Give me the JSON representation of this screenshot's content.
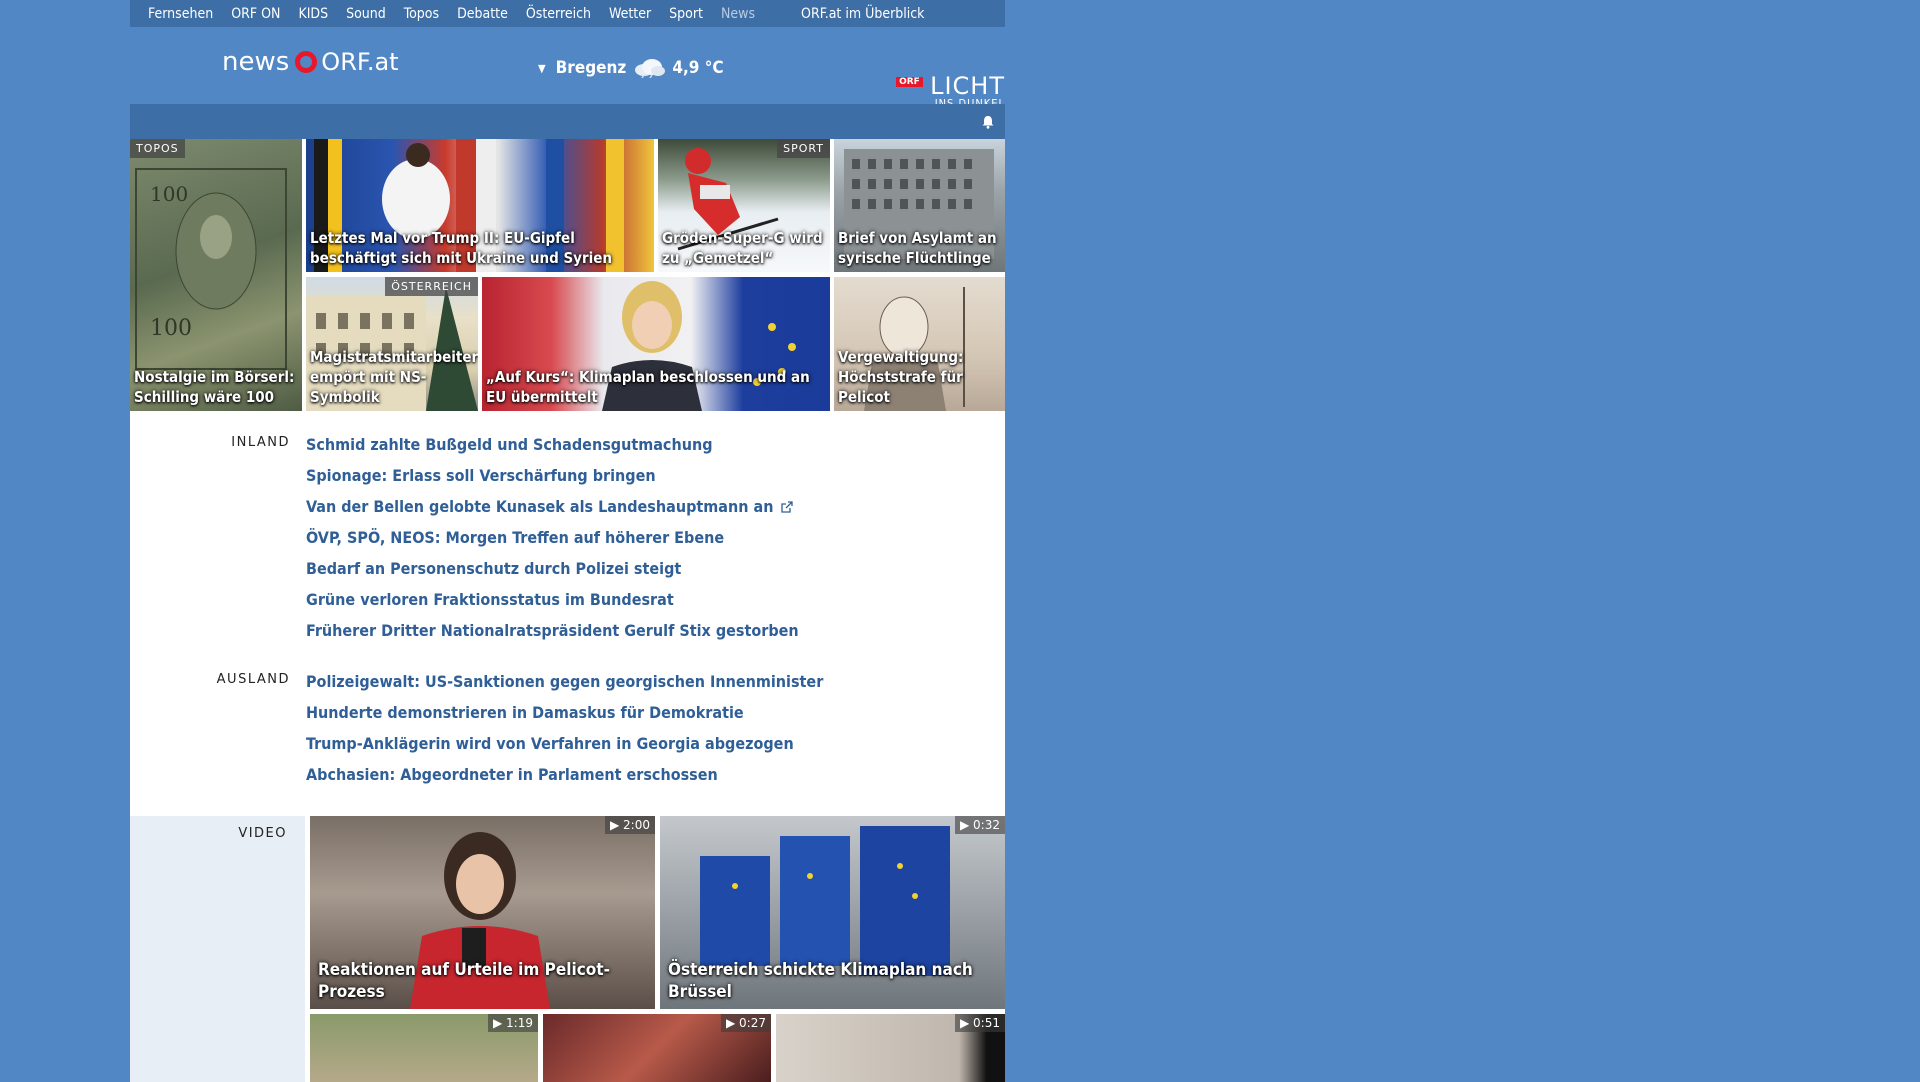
{
  "topnav": {
    "items": [
      "Fernsehen",
      "ORF ON",
      "KIDS",
      "Sound",
      "Topos",
      "Debatte",
      "Österreich",
      "Wetter",
      "Sport",
      "News"
    ],
    "overview": "ORF.at im Überblick"
  },
  "header": {
    "logo_news": "news",
    "logo_orf": "ORF.at",
    "weather_city": "Bregenz",
    "weather_temp": "4,9 °C",
    "licht_badge": "ORF",
    "licht_big": "LICHT",
    "licht_small": "INS DUNKEL"
  },
  "tiles": [
    {
      "tag": "TOPOS",
      "label": "Nostalgie im Börserl: Schilling wäre 100"
    },
    {
      "tag": "",
      "label": "Letztes Mal vor Trump II: EU-Gipfel beschäftigt sich mit Ukraine und Syrien"
    },
    {
      "tag": "SPORT",
      "label": "Gröden-Super-G wird zu „Gemetzel“"
    },
    {
      "tag": "",
      "label": "Brief von Asylamt an syrische Flüchtlinge"
    },
    {
      "tag": "ÖSTERREICH",
      "label": "Magistratsmitarbeiter empört mit NS-Symbolik"
    },
    {
      "tag": "",
      "label": "„Auf Kurs“: Klimaplan beschlossen und an EU übermittelt"
    },
    {
      "tag": "",
      "label": "Vergewaltigung: Höchststrafe für Pelicot"
    }
  ],
  "inland": {
    "heading": "INLAND",
    "items": [
      "Schmid zahlte Bußgeld und Schadensgutmachung",
      "Spionage: Erlass soll Verschärfung bringen",
      "Van der Bellen gelobte Kunasek als Landeshauptmann an",
      "ÖVP, SPÖ, NEOS: Morgen Treffen auf höherer Ebene",
      "Bedarf an Personenschutz durch Polizei steigt",
      "Grüne verloren Fraktionsstatus im Bundesrat",
      "Früherer Dritter Nationalratspräsident Gerulf Stix gestorben"
    ]
  },
  "ausland": {
    "heading": "AUSLAND",
    "items": [
      "Polizeigewalt: US-Sanktionen gegen georgischen Innenminister",
      "Hunderte demonstrieren in Damaskus für Demokratie",
      "Trump-Anklägerin wird von Verfahren in Georgia abgezogen",
      "Abchasien: Abgeordneter in Parlament erschossen"
    ]
  },
  "video": {
    "heading": "VIDEO",
    "items": [
      {
        "duration": "▶ 2:00",
        "label": "Reaktionen auf Urteile im Pelicot-Prozess"
      },
      {
        "duration": "▶ 0:32",
        "label": "Österreich schickte Klimaplan nach Brüssel"
      },
      {
        "duration": "▶ 1:19",
        "label": ""
      },
      {
        "duration": "▶ 0:27",
        "label": ""
      },
      {
        "duration": "▶ 0:51",
        "label": ""
      }
    ]
  },
  "colors": {
    "background": "#5187c4",
    "navbar": "#3d6ea5",
    "link": "#2f5f96",
    "orf_red": "#e8182a"
  }
}
